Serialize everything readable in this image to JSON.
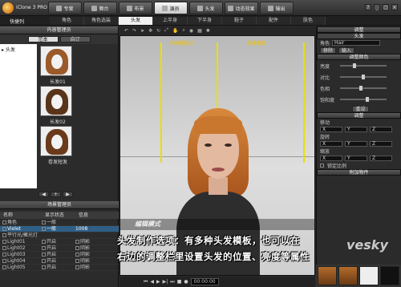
{
  "app": {
    "name": "iClone 3 PRO"
  },
  "main_tabs": [
    {
      "label": "专案"
    },
    {
      "label": "舞台"
    },
    {
      "label": "布景"
    },
    {
      "label": "演员"
    },
    {
      "label": "头发"
    },
    {
      "label": "动态效果"
    },
    {
      "label": "输出"
    }
  ],
  "main_tab_active": 3,
  "mode": "快捷列",
  "sub_tabs": [
    {
      "label": "角色"
    },
    {
      "label": "角色选装"
    },
    {
      "label": "头发"
    },
    {
      "label": "上半身"
    },
    {
      "label": "下半身"
    },
    {
      "label": "鞋子"
    },
    {
      "label": "配件"
    },
    {
      "label": "肤色"
    }
  ],
  "content_manager": {
    "title": "内容管理员",
    "tabs": [
      "范本",
      "自订"
    ],
    "tree_root": "头发",
    "thumbnails": [
      {
        "caption": "长发01"
      },
      {
        "caption": "长发02"
      },
      {
        "caption": "卷发短发"
      }
    ]
  },
  "scene_manager": {
    "title": "场景管理员",
    "columns": [
      "名称",
      "显示状态",
      "信息"
    ],
    "rows": [
      {
        "name": "角色",
        "status": "一般",
        "info": "",
        "selected": false
      },
      {
        "name": "Violet",
        "status": "一般",
        "info": "1008",
        "selected": true
      },
      {
        "name": "平行光/聚光灯",
        "status": "",
        "info": "",
        "selected": false
      },
      {
        "name": "Light01",
        "status": "开启",
        "info": "阴影",
        "selected": false
      },
      {
        "name": "Light02",
        "status": "开启",
        "info": "阴影",
        "selected": false
      },
      {
        "name": "Light03",
        "status": "开启",
        "info": "阴影",
        "selected": false
      },
      {
        "name": "Light04",
        "status": "开启",
        "info": "阴影",
        "selected": false
      },
      {
        "name": "Light05",
        "status": "开启",
        "info": "阴影",
        "selected": false
      }
    ]
  },
  "viewport": {
    "label_left": "预览模版中",
    "label_right": "快速着色",
    "edit_mode": "编辑模式"
  },
  "caption": {
    "line1": "头发制作选项：有多种头发模板，也可以在",
    "line2": "右边的调整栏里设置头发的位置、亮度等属性"
  },
  "right_panel": {
    "title": "调整",
    "section_hair": "头发",
    "role_label": "角色",
    "role_value": "Hair",
    "btn_remove": "移除",
    "btn_import": "输入",
    "section_color": "调整颜色",
    "props": [
      {
        "label": "亮度",
        "value": 0.3
      },
      {
        "label": "对比",
        "value": 0.5
      },
      {
        "label": "色相",
        "value": 0.45
      },
      {
        "label": "饱和度",
        "value": 0.6
      }
    ],
    "reset": "重设",
    "section_transform": "调整",
    "move_label": "移动",
    "rotate_label": "旋转",
    "scale_label": "缩放",
    "lock_label": "锁定比例",
    "section_attach": "附加物件"
  },
  "timeline": {
    "timecode": "00:00:00"
  },
  "watermark": "vesky"
}
